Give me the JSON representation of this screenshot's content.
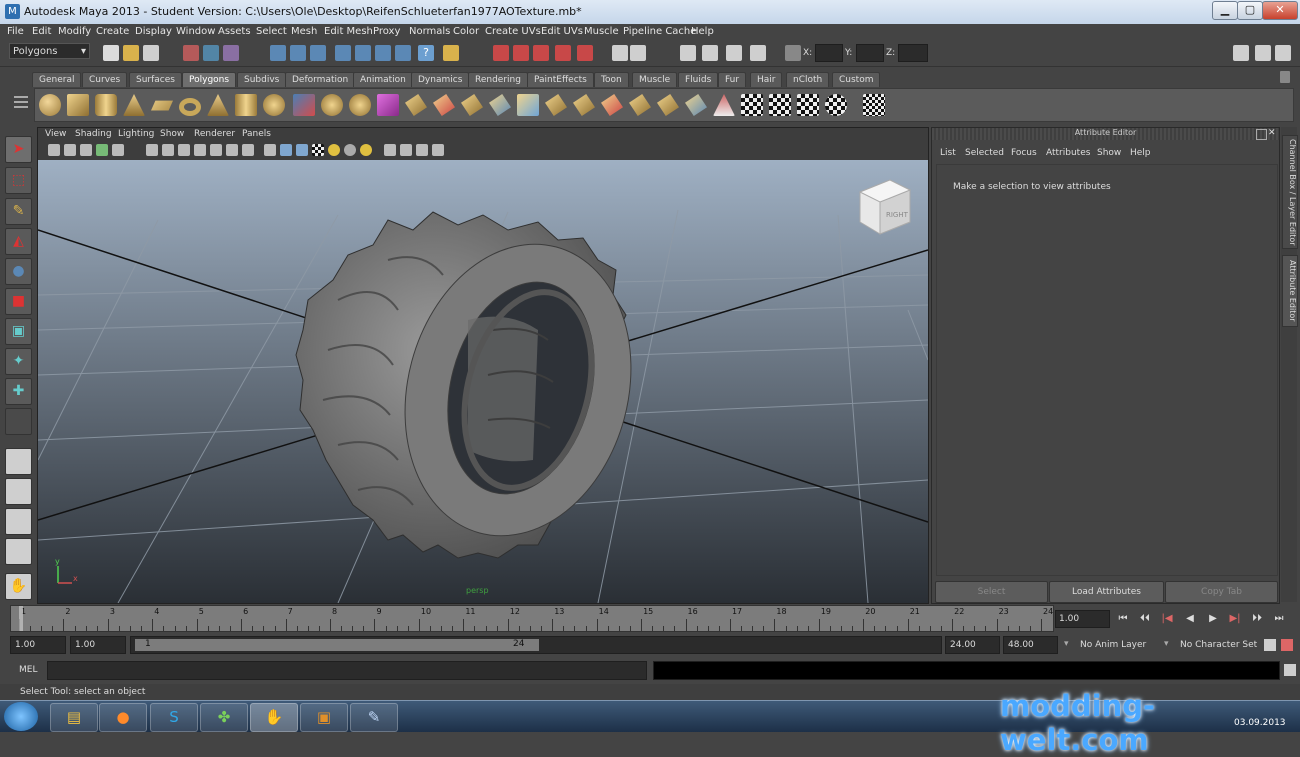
{
  "window": {
    "title": "Autodesk Maya 2013 - Student Version: C:\\Users\\Ole\\Desktop\\ReifenSchlueterfan1977AOTexture.mb*",
    "minimize": "▁",
    "maximize": "▢",
    "close": "✕"
  },
  "menu": [
    "File",
    "Edit",
    "Modify",
    "Create",
    "Display",
    "Window",
    "Assets",
    "Select",
    "Mesh",
    "Edit Mesh",
    "Proxy",
    "Normals",
    "Color",
    "Create UVs",
    "Edit UVs",
    "Muscle",
    "Pipeline Cache",
    "Help"
  ],
  "status": {
    "mode": "Polygons",
    "x_label": "X:",
    "y_label": "Y:",
    "z_label": "Z:"
  },
  "shelf": {
    "tabs": [
      "General",
      "Curves",
      "Surfaces",
      "Polygons",
      "Subdivs",
      "Deformation",
      "Animation",
      "Dynamics",
      "Rendering",
      "PaintEffects",
      "Toon",
      "Muscle",
      "Fluids",
      "Fur",
      "Hair",
      "nCloth",
      "Custom"
    ],
    "active_tab": "Polygons"
  },
  "viewport": {
    "menu": [
      "View",
      "Shading",
      "Lighting",
      "Show",
      "Renderer",
      "Panels"
    ],
    "camera_label": "persp",
    "viewcube_label": "RIGHT",
    "axis_x": "x",
    "axis_y": "y"
  },
  "attribute_editor": {
    "title": "Attribute Editor",
    "menu": [
      "List",
      "Selected",
      "Focus",
      "Attributes",
      "Show",
      "Help"
    ],
    "message": "Make a selection to view attributes",
    "buttons": {
      "select": "Select",
      "load": "Load Attributes",
      "copy": "Copy Tab"
    }
  },
  "side_tabs": [
    "Channel Box / Layer Editor",
    "Attribute Editor"
  ],
  "timeline": {
    "ticks": [
      1,
      2,
      3,
      4,
      5,
      6,
      7,
      8,
      9,
      10,
      11,
      12,
      13,
      14,
      15,
      16,
      17,
      18,
      19,
      20,
      21,
      22,
      23,
      24
    ],
    "current_frame": "1.00"
  },
  "playback": [
    "⏮",
    "⏴⏴",
    "|◀",
    "◀",
    "▶",
    "▶|",
    "⏵⏵",
    "⏭"
  ],
  "range": {
    "start": "1.00",
    "start2": "1.00",
    "slider_start": "1",
    "slider_end": "24",
    "end": "24.00",
    "end2": "48.00",
    "anim_layer": "No Anim Layer",
    "char_set": "No Character Set"
  },
  "command": {
    "label": "MEL"
  },
  "help_line": "Select Tool: select an object",
  "watermark": {
    "text": "modding-welt.com",
    "date": "03.09.2013"
  },
  "colors": {
    "maya_bg": "#444444",
    "viewport_top": "#9fb0c3",
    "viewport_bottom": "#2a2f35",
    "accent": "#5285a6"
  }
}
